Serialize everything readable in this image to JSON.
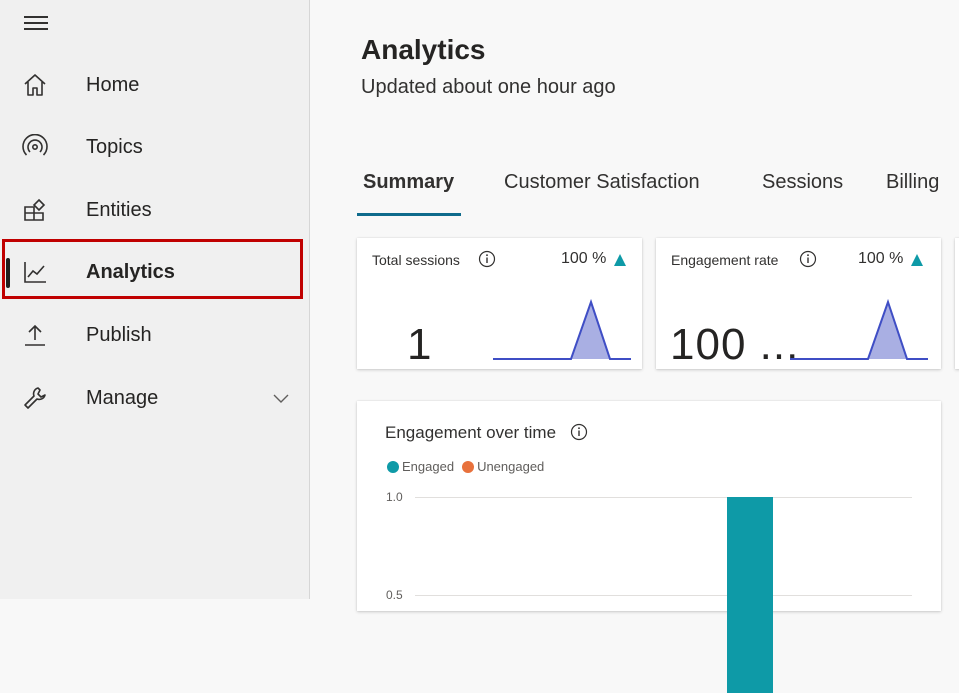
{
  "sidebar": {
    "items": [
      {
        "label": "Home",
        "icon": "home-icon"
      },
      {
        "label": "Topics",
        "icon": "topics-icon"
      },
      {
        "label": "Entities",
        "icon": "entities-icon"
      },
      {
        "label": "Analytics",
        "icon": "analytics-icon",
        "active": true
      },
      {
        "label": "Publish",
        "icon": "publish-icon"
      },
      {
        "label": "Manage",
        "icon": "manage-icon",
        "expandable": true
      }
    ]
  },
  "header": {
    "title": "Analytics",
    "subtitle": "Updated about one hour ago"
  },
  "tabs": [
    {
      "label": "Summary",
      "active": true
    },
    {
      "label": "Customer Satisfaction"
    },
    {
      "label": "Sessions"
    },
    {
      "label": "Billing"
    }
  ],
  "kpis": [
    {
      "label": "Total sessions",
      "change": "100 %",
      "trend": "up",
      "value": "1"
    },
    {
      "label": "Engagement rate",
      "change": "100 %",
      "trend": "up",
      "value": "100 ..."
    }
  ],
  "engagement_chart": {
    "title": "Engagement over time",
    "legend": [
      {
        "name": "Engaged",
        "color": "#0e9aa7"
      },
      {
        "name": "Unengaged",
        "color": "#e8713c"
      }
    ]
  },
  "chart_data": {
    "type": "bar",
    "title": "Engagement over time",
    "series": [
      {
        "name": "Engaged",
        "values": [
          1.0
        ]
      },
      {
        "name": "Unengaged",
        "values": [
          0
        ]
      }
    ],
    "y_ticks": [
      "1.0",
      "0.5"
    ],
    "ylim": [
      0,
      1.0
    ],
    "grid": true,
    "legend_position": "top-left"
  },
  "colors": {
    "accent": "#0f6b8c",
    "engaged": "#0e9aa7",
    "unengaged": "#e8713c",
    "spark_fill": "#a9afe3",
    "spark_line": "#3f4ec5",
    "trend_up": "#0e9aa7",
    "highlight": "#c00000"
  }
}
